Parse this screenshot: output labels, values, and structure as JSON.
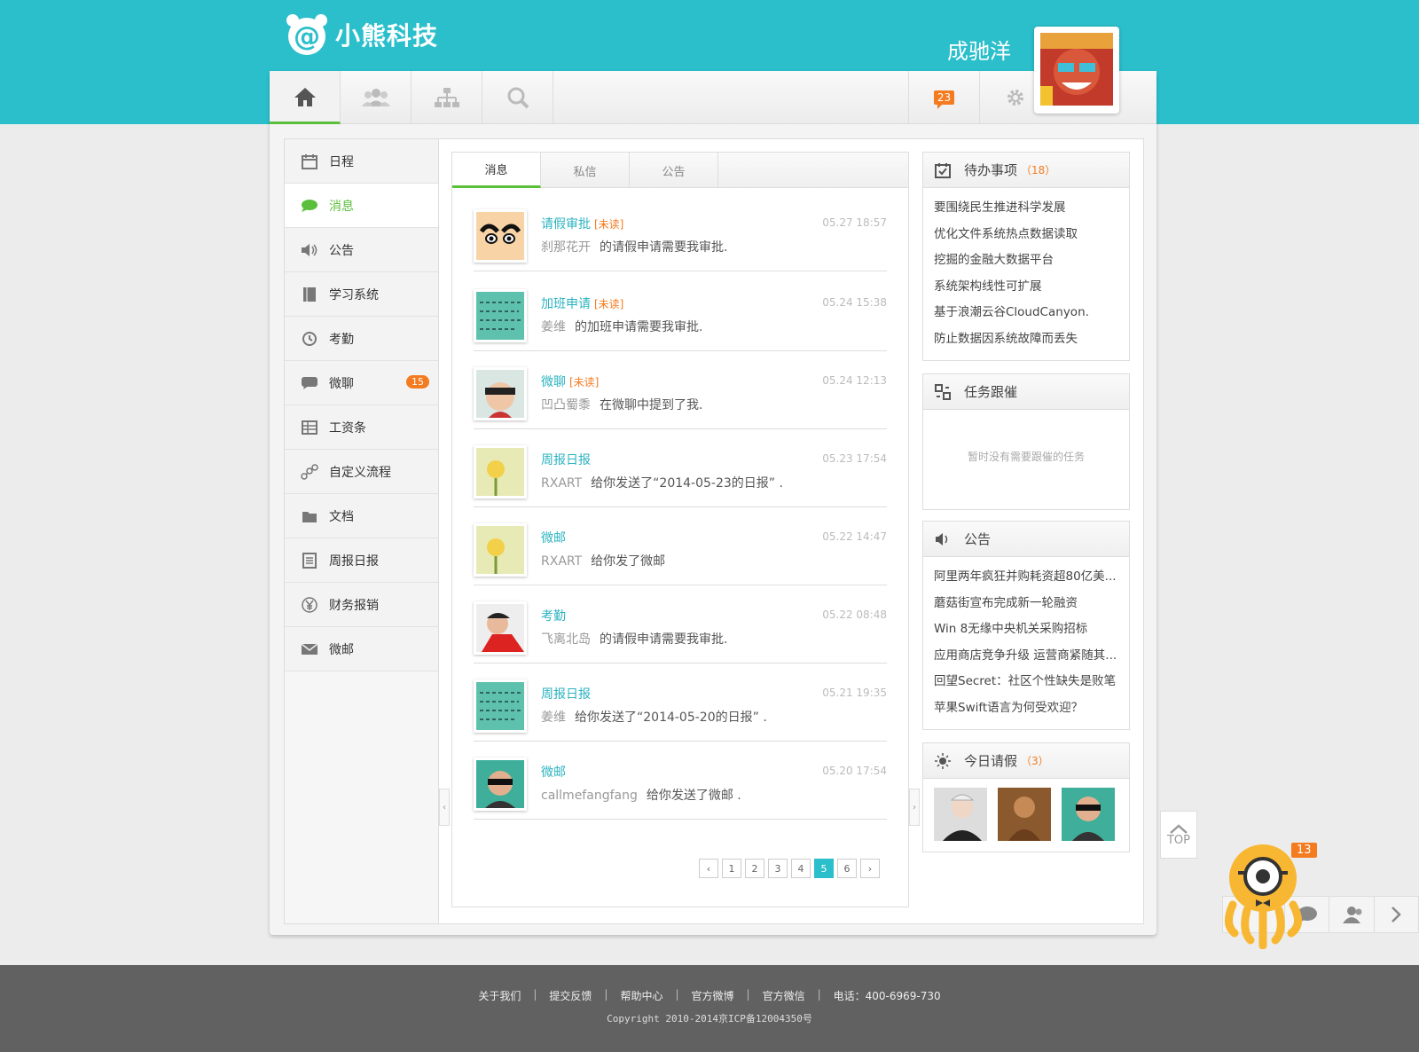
{
  "header": {
    "brand": "小熊科技",
    "user_name": "成驰洋",
    "message_count": "23"
  },
  "nav": {
    "icons": [
      "home-icon",
      "people-icon",
      "org-chart-icon",
      "search-icon"
    ],
    "right_icons": [
      "message-icon",
      "gear-icon"
    ]
  },
  "sidebar": {
    "items": [
      {
        "label": "日程",
        "icon": "calendar-icon"
      },
      {
        "label": "消息",
        "icon": "chat-bubble-icon"
      },
      {
        "label": "公告",
        "icon": "speaker-icon"
      },
      {
        "label": "学习系统",
        "icon": "book-icon"
      },
      {
        "label": "考勤",
        "icon": "history-clock-icon"
      },
      {
        "label": "微聊",
        "icon": "speech-icon",
        "badge": "15"
      },
      {
        "label": "工资条",
        "icon": "table-icon"
      },
      {
        "label": "自定义流程",
        "icon": "flow-icon"
      },
      {
        "label": "文档",
        "icon": "folder-icon"
      },
      {
        "label": "周报日报",
        "icon": "report-icon"
      },
      {
        "label": "财务报销",
        "icon": "yen-icon"
      },
      {
        "label": "微邮",
        "icon": "mail-icon"
      }
    ]
  },
  "feed": {
    "tabs": [
      "消息",
      "私信",
      "公告"
    ],
    "messages": [
      {
        "title": "请假审批",
        "unread": "[未读]",
        "time": "05.27 18:57",
        "who": "刹那花开",
        "what": "的请假申请需要我审批."
      },
      {
        "title": "加班申请",
        "unread": "[未读]",
        "time": "05.24 15:38",
        "who": "姜维",
        "what": "的加班申请需要我审批."
      },
      {
        "title": "微聊",
        "unread": "[未读]",
        "time": "05.24 12:13",
        "who": "凹凸蜀黍",
        "what": "在微聊中提到了我."
      },
      {
        "title": "周报日报",
        "unread": "",
        "time": "05.23 17:54",
        "who": "RXART",
        "what": "给你发送了“2014-05-23的日报” ."
      },
      {
        "title": "微邮",
        "unread": "",
        "time": "05.22 14:47",
        "who": "RXART",
        "what": "给你发了微邮"
      },
      {
        "title": "考勤",
        "unread": "",
        "time": "05.22 08:48",
        "who": "飞离北岛",
        "what": "的请假申请需要我审批."
      },
      {
        "title": "周报日报",
        "unread": "",
        "time": "05.21 19:35",
        "who": "姜维",
        "what": "给你发送了“2014-05-20的日报” ."
      },
      {
        "title": "微邮",
        "unread": "",
        "time": "05.20 17:54",
        "who": "callmefangfang",
        "what": "给你发送了微邮 ."
      }
    ],
    "pages": [
      "1",
      "2",
      "3",
      "4",
      "5",
      "6"
    ],
    "current_page": "5"
  },
  "todo": {
    "title": "待办事项",
    "count": "（18）",
    "items": [
      "要围绕民生推进科学发展",
      "优化文件系统热点数据读取",
      "挖掘的金融大数据平台",
      "系统架构线性可扩展",
      "基于浪潮云谷CloudCanyon.",
      "防止数据因系统故障而丢失"
    ]
  },
  "tasks": {
    "title": "任务跟催",
    "empty_text": "暂时没有需要跟催的任务"
  },
  "notice": {
    "title": "公告",
    "items": [
      "阿里两年疯狂并购耗资超80亿美...",
      "蘑菇街宣布完成新一轮融资",
      "Win 8无缘中央机关采购招标",
      "应用商店竞争升级 运营商紧随其...",
      "回望Secret：社区个性缺失是败笔",
      "苹果Swift语言为何受欢迎？"
    ]
  },
  "leave": {
    "title": "今日请假",
    "count": "（3）"
  },
  "float": {
    "top_label": "TOP",
    "badge": "13"
  },
  "footer": {
    "links": [
      "关于我们",
      "提交反馈",
      "帮助中心",
      "官方微博",
      "官方微信",
      "电话：400-6969-730"
    ],
    "copyright": "Copyright 2010-2014京ICP备12004350号"
  },
  "colors": {
    "accent": "#2bbfcb",
    "active_green": "#5bbf3c",
    "badge_orange": "#f47b20",
    "footer": "#616161"
  }
}
